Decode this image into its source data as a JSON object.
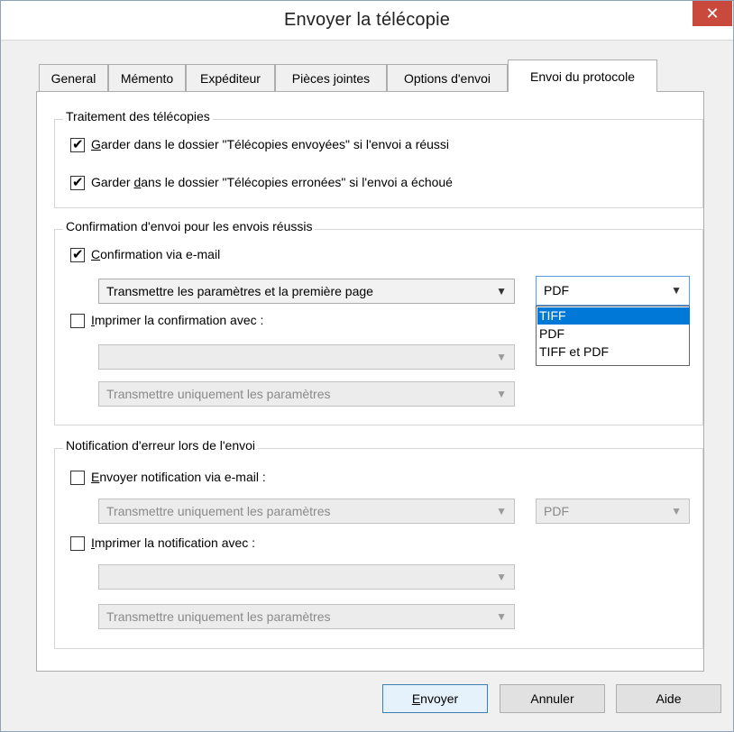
{
  "window": {
    "title": "Envoyer la télécopie",
    "close_symbol": "✕"
  },
  "tabs": [
    {
      "label": "General",
      "active": false
    },
    {
      "label": "Mémento",
      "active": false
    },
    {
      "label": "Expéditeur",
      "active": false
    },
    {
      "label": "Pièces jointes",
      "active": false
    },
    {
      "label": "Options d'envoi",
      "active": false
    },
    {
      "label": "Envoi du protocole",
      "active": true
    }
  ],
  "group_fax": {
    "legend": "Traitement des télécopies",
    "keep_sent": {
      "checked": true,
      "ul": "G",
      "rest": "arder dans le dossier \"Télécopies envoyées\" si l'envoi a réussi"
    },
    "keep_failed": {
      "checked": true,
      "pre": "Garder ",
      "ul": "d",
      "rest": "ans le dossier \"Télécopies erronées\" si l'envoi a échoué"
    }
  },
  "group_confirm": {
    "legend": "Confirmation d'envoi pour les envois réussis",
    "email": {
      "checked": true,
      "ul": "C",
      "rest": "onfirmation via e-mail"
    },
    "email_content": "Transmettre les paramètres et la première page",
    "format_value": "PDF",
    "format_options": [
      "TIFF",
      "PDF",
      "TIFF et PDF"
    ],
    "format_selected_option": "TIFF",
    "print": {
      "checked": false,
      "ul": "I",
      "rest": "mprimer la confirmation avec :"
    },
    "print_printer": "",
    "print_content": "Transmettre uniquement les paramètres"
  },
  "group_error": {
    "legend": "Notification d'erreur lors de l'envoi",
    "email": {
      "checked": false,
      "ul": "E",
      "rest": "nvoyer notification via e-mail :"
    },
    "email_content": "Transmettre uniquement les paramètres",
    "format_value": "PDF",
    "print": {
      "checked": false,
      "ul": "I",
      "rest": "mprimer la notification avec :"
    },
    "print_printer": "",
    "print_content": "Transmettre uniquement les paramètres"
  },
  "buttons": {
    "send": {
      "ul": "E",
      "rest": "nvoyer"
    },
    "cancel": "Annuler",
    "help": "Aide"
  },
  "icons": {
    "dropdown_arrow": "chevron-down-icon",
    "check": "checkmark-icon"
  }
}
